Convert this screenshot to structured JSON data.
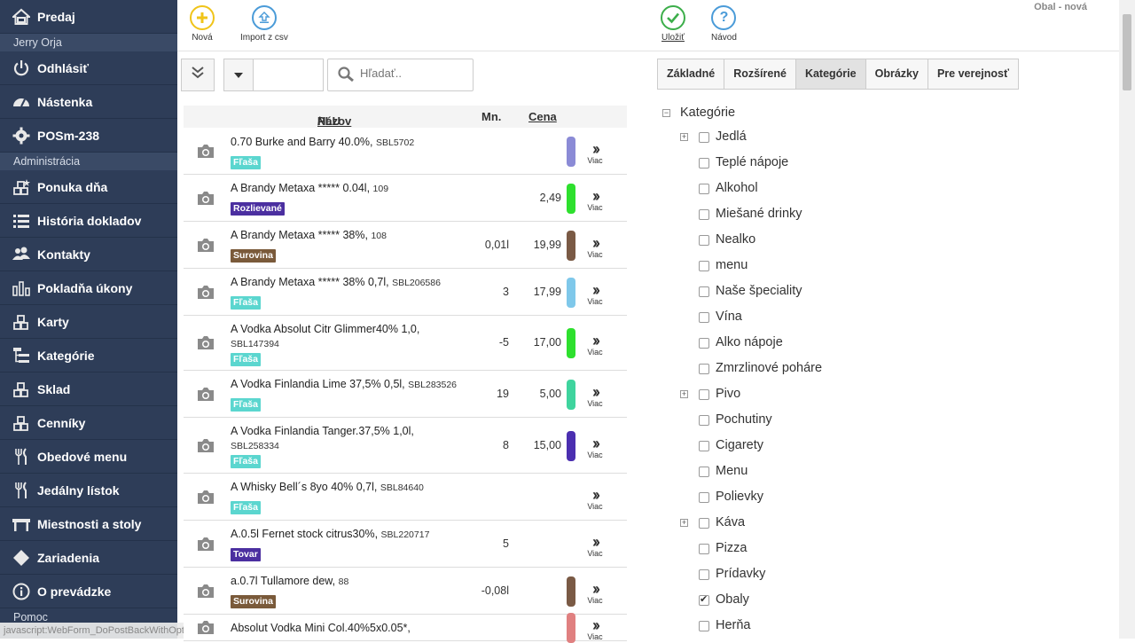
{
  "sidebar": {
    "predaj": "Predaj",
    "user": "Jerry Orja",
    "logout": "Odhlásiť",
    "dashboard": "Nástenka",
    "pos": "POSm-238",
    "admin_section": "Administrácia",
    "items": [
      {
        "label": "Ponuka dňa",
        "icon": "blocks-star-icon"
      },
      {
        "label": "História dokladov",
        "icon": "list-icon"
      },
      {
        "label": "Kontakty",
        "icon": "users-icon"
      },
      {
        "label": "Pokladňa úkony",
        "icon": "bar-chart-icon"
      },
      {
        "label": "Karty",
        "icon": "blocks-icon"
      },
      {
        "label": "Kategórie",
        "icon": "tree-icon"
      },
      {
        "label": "Sklad",
        "icon": "blocks-icon"
      },
      {
        "label": "Cenníky",
        "icon": "blocks-icon"
      },
      {
        "label": "Obedové menu",
        "icon": "cutlery-icon"
      },
      {
        "label": "Jedálny lístok",
        "icon": "cutlery-icon"
      },
      {
        "label": "Miestnosti a stoly",
        "icon": "table-icon"
      },
      {
        "label": "Zariadenia",
        "icon": "diamond-icon"
      },
      {
        "label": "O prevádzke",
        "icon": "info-icon"
      }
    ],
    "help": "Pomoc",
    "status_url": "javascript:WebForm_DoPostBackWithOptions(new WebForm_PostBackOptions("
  },
  "toolbar": {
    "new_label": "Nová",
    "import_label": "Import z csv",
    "save_label": "Uložiť",
    "help_label": "Návod",
    "obal": "Obal - nová"
  },
  "filter": {
    "search_placeholder": "Hľadať.."
  },
  "list": {
    "col_name": "Názov",
    "col_sep": " / ",
    "col_plu": "PLU",
    "col_qty": "Mn.",
    "col_price": "Cena",
    "more_label": "Viac",
    "rows": [
      {
        "name": "0.70 Burke and Barry 40.0%,",
        "plu": "SBL5702",
        "tag": "Fľaša",
        "tag_color": "#5bd6cf",
        "qty": "",
        "price": "",
        "bar": "#8b8bd6"
      },
      {
        "name": "A Brandy Metaxa ***** 0.04l,",
        "plu": "109",
        "tag": "Rozlievané",
        "tag_color": "#4b2fa0",
        "qty": "",
        "price": "2,49",
        "bar": "#2ee02e"
      },
      {
        "name": "A Brandy Metaxa ***** 38%,",
        "plu": "108",
        "tag": "Surovina",
        "tag_color": "#7a5a3a",
        "qty": "0,01l",
        "price": "19,99",
        "bar": "#7a5a45"
      },
      {
        "name": "A Brandy Metaxa ***** 38% 0,7l,",
        "plu": "SBL206586",
        "tag": "Fľaša",
        "tag_color": "#5bd6cf",
        "qty": "3",
        "price": "17,99",
        "bar": "#7fc8ea"
      },
      {
        "name": "A Vodka Absolut Citr Glimmer40% 1,0,",
        "plu": "SBL147394",
        "tag": "Fľaša",
        "tag_color": "#5bd6cf",
        "qty": "-5",
        "price": "17,00",
        "bar": "#2ee02e"
      },
      {
        "name": "A Vodka Finlandia Lime 37,5% 0,5l,",
        "plu": "SBL283526",
        "tag": "Fľaša",
        "tag_color": "#5bd6cf",
        "qty": "19",
        "price": "5,00",
        "bar": "#3fd49e"
      },
      {
        "name": "A Vodka Finlandia Tanger.37,5% 1,0l,",
        "plu": "SBL258334",
        "tag": "Fľaša",
        "tag_color": "#5bd6cf",
        "qty": "8",
        "price": "15,00",
        "bar": "#4b2fb0"
      },
      {
        "name": "A Whisky Bell´s 8yo 40% 0,7l,",
        "plu": "SBL84640",
        "tag": "Fľaša",
        "tag_color": "#5bd6cf",
        "qty": "",
        "price": "",
        "bar": ""
      },
      {
        "name": "A.0.5l Fernet stock citrus30%,",
        "plu": "SBL220717",
        "tag": "Tovar",
        "tag_color": "#4b2fa0",
        "qty": "5",
        "price": "",
        "bar": ""
      },
      {
        "name": "a.0.7l Tullamore dew,",
        "plu": "88",
        "tag": "Surovina",
        "tag_color": "#7a5a3a",
        "qty": "-0,08l",
        "price": "",
        "bar": "#7a5a45"
      },
      {
        "name": "Absolut Vodka Mini Col.40%5x0.05*,",
        "plu": "",
        "tag": "",
        "tag_color": "",
        "qty": "",
        "price": "",
        "bar": "#e08080"
      }
    ]
  },
  "tabs": [
    "Základné",
    "Rozšírené",
    "Kategórie",
    "Obrázky",
    "Pre verejnosť"
  ],
  "active_tab": 2,
  "tree": {
    "root": "Kategórie",
    "items": [
      {
        "label": "Jedlá",
        "expand": true,
        "checked": false
      },
      {
        "label": "Teplé nápoje",
        "expand": false,
        "checked": false
      },
      {
        "label": "Alkohol",
        "expand": false,
        "checked": false
      },
      {
        "label": "Miešané drinky",
        "expand": false,
        "checked": false
      },
      {
        "label": "Nealko",
        "expand": false,
        "checked": false
      },
      {
        "label": "menu",
        "expand": false,
        "checked": false
      },
      {
        "label": "Naše špeciality",
        "expand": false,
        "checked": false
      },
      {
        "label": "Vína",
        "expand": false,
        "checked": false
      },
      {
        "label": "Alko nápoje",
        "expand": false,
        "checked": false
      },
      {
        "label": "Zmrzlinové poháre",
        "expand": false,
        "checked": false
      },
      {
        "label": "Pivo",
        "expand": true,
        "checked": false
      },
      {
        "label": "Pochutiny",
        "expand": false,
        "checked": false
      },
      {
        "label": "Cigarety",
        "expand": false,
        "checked": false
      },
      {
        "label": "Menu",
        "expand": false,
        "checked": false
      },
      {
        "label": "Polievky",
        "expand": false,
        "checked": false
      },
      {
        "label": "Káva",
        "expand": true,
        "checked": false
      },
      {
        "label": "Pizza",
        "expand": false,
        "checked": false
      },
      {
        "label": "Prídavky",
        "expand": false,
        "checked": false
      },
      {
        "label": "Obaly",
        "expand": false,
        "checked": true
      },
      {
        "label": "Herňa",
        "expand": false,
        "checked": false
      }
    ]
  }
}
